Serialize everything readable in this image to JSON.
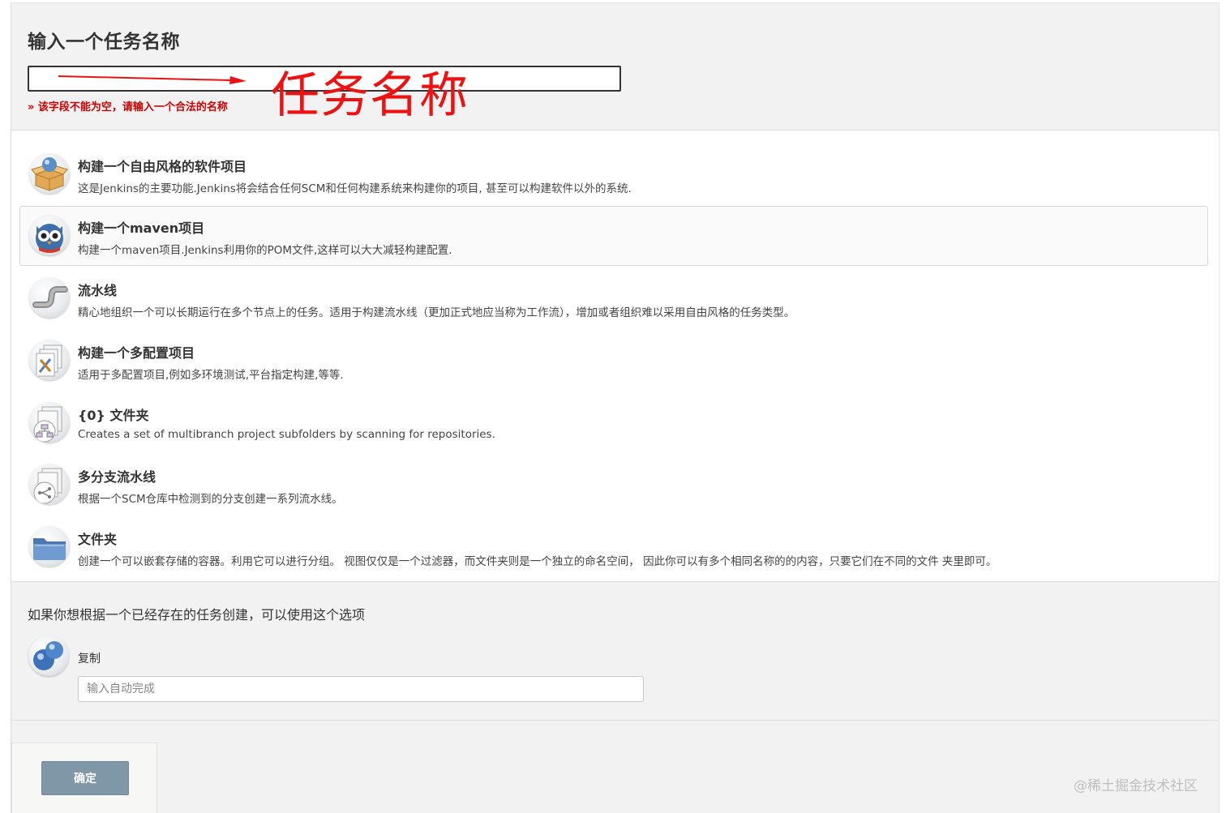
{
  "header": {
    "title": "输入一个任务名称",
    "name_input_value": "",
    "error_message": "» 该字段不能为空，请输入一个合法的名称",
    "annotation": "任务名称"
  },
  "item_types": [
    {
      "label": "构建一个自由风格的软件项目",
      "description": "这是Jenkins的主要功能.Jenkins将会结合任何SCM和任何构建系统来构建你的项目, 甚至可以构建软件以外的系统.",
      "icon": "freestyle-box-icon",
      "selected": false
    },
    {
      "label": "构建一个maven项目",
      "description": "构建一个maven项目.Jenkins利用你的POM文件,这样可以大大减轻构建配置.",
      "icon": "maven-owl-icon",
      "selected": true
    },
    {
      "label": "流水线",
      "description": "精心地组织一个可以长期运行在多个节点上的任务。适用于构建流水线（更加正式地应当称为工作流），增加或者组织难以采用自由风格的任务类型。",
      "icon": "pipeline-icon",
      "selected": false
    },
    {
      "label": "构建一个多配置项目",
      "description": "适用于多配置项目,例如多环境测试,平台指定构建,等等.",
      "icon": "multi-config-icon",
      "selected": false
    },
    {
      "label": "{0} 文件夹",
      "description": "Creates a set of multibranch project subfolders by scanning for repositories.",
      "icon": "org-folder-icon",
      "selected": false
    },
    {
      "label": "多分支流水线",
      "description": "根据一个SCM仓库中检测到的分支创建一系列流水线。",
      "icon": "multibranch-icon",
      "selected": false
    },
    {
      "label": "文件夹",
      "description": "创建一个可以嵌套存储的容器。利用它可以进行分组。 视图仅仅是一个过滤器，而文件夹则是一个独立的命名空间， 因此你可以有多个相同名称的的内容，只要它们在不同的文件 夹里即可。",
      "icon": "folder-icon",
      "selected": false
    }
  ],
  "copy": {
    "heading": "如果你想根据一个已经存在的任务创建，可以使用这个选项",
    "label": "复制",
    "placeholder": "输入自动完成",
    "icon": "copy-spheres-icon"
  },
  "footer": {
    "ok_label": "确定"
  },
  "watermark": "@稀土掘金技术社区",
  "colors": {
    "error_red": "#cc0000",
    "annotation_red": "#ee1111",
    "button_bg": "#7f97a6",
    "page_bg": "#f2f2f2"
  }
}
